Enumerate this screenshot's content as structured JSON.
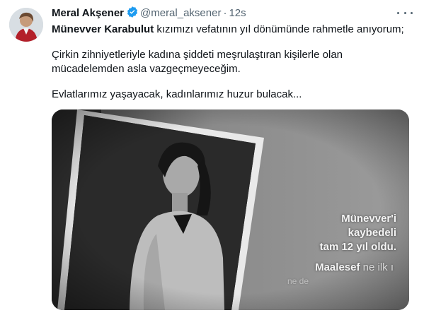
{
  "tweet": {
    "author_name": "Meral Akşener",
    "handle": "@meral_aksener",
    "separator": "·",
    "time": "12s",
    "line1_bold": "Münevver Karabulut",
    "line1_rest": " kızımızı vefatının yıl dönümünde rahmetle anıyorum;",
    "para2": "Çirkin zihniyetleriyle kadına şiddeti meşrulaştıran kişilerle olan mücadelemden asla vazgeçmeyeceğim.",
    "para3": "Evlatlarımız yaşayacak, kadınlarımız huzur bulacak..."
  },
  "media": {
    "overlay_line1": "Münevver'i",
    "overlay_line2": "kaybedeli",
    "overlay_line3": "tam 12 yıl oldu.",
    "overlay_line4_a": "Maalesef",
    "overlay_line4_b": " ne ilk ı",
    "overlay_line5": "ne de"
  },
  "colors": {
    "verified_badge": "#1d9bf0",
    "secondary_text": "#536471",
    "primary_text": "#0f1419"
  }
}
